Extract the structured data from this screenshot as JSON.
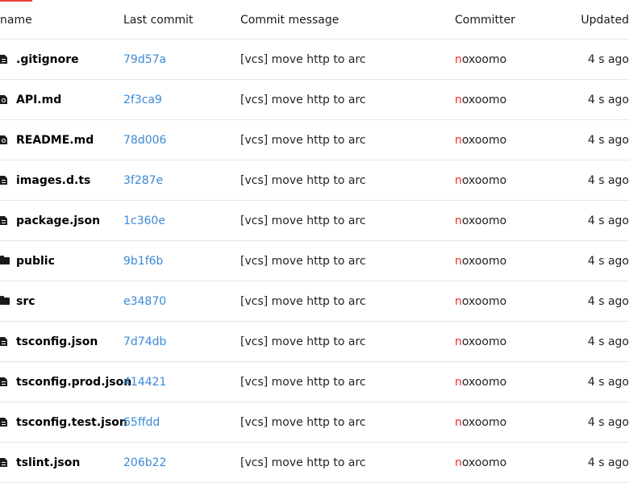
{
  "colors": {
    "accent": "#e5403a",
    "link": "#3a8ad6",
    "committer_initial": "#e5302a"
  },
  "header": {
    "name": "name",
    "last_commit": "Last commit",
    "commit_message": "Commit message",
    "committer": "Committer",
    "updated": "Updated"
  },
  "rows": [
    {
      "name": ".gitignore",
      "icon": "file-icon",
      "commit": "79d57a",
      "message": "[vcs] move http to arc",
      "committer_initial": "n",
      "committer_rest": "oxoomo",
      "updated": "4 s ago"
    },
    {
      "name": "API.md",
      "icon": "markdown-file-icon",
      "commit": "2f3ca9",
      "message": "[vcs] move http to arc",
      "committer_initial": "n",
      "committer_rest": "oxoomo",
      "updated": "4 s ago"
    },
    {
      "name": "README.md",
      "icon": "markdown-file-icon",
      "commit": "78d006",
      "message": "[vcs] move http to arc",
      "committer_initial": "n",
      "committer_rest": "oxoomo",
      "updated": "4 s ago"
    },
    {
      "name": "images.d.ts",
      "icon": "file-icon",
      "commit": "3f287e",
      "message": "[vcs] move http to arc",
      "committer_initial": "n",
      "committer_rest": "oxoomo",
      "updated": "4 s ago"
    },
    {
      "name": "package.json",
      "icon": "file-icon",
      "commit": "1c360e",
      "message": "[vcs] move http to arc",
      "committer_initial": "n",
      "committer_rest": "oxoomo",
      "updated": "4 s ago"
    },
    {
      "name": "public",
      "icon": "folder-icon",
      "commit": "9b1f6b",
      "message": "[vcs] move http to arc",
      "committer_initial": "n",
      "committer_rest": "oxoomo",
      "updated": "4 s ago"
    },
    {
      "name": "src",
      "icon": "folder-icon",
      "commit": "e34870",
      "message": "[vcs] move http to arc",
      "committer_initial": "n",
      "committer_rest": "oxoomo",
      "updated": "4 s ago"
    },
    {
      "name": "tsconfig.json",
      "icon": "file-icon",
      "commit": "7d74db",
      "message": "[vcs] move http to arc",
      "committer_initial": "n",
      "committer_rest": "oxoomo",
      "updated": "4 s ago"
    },
    {
      "name": "tsconfig.prod.json",
      "icon": "file-icon",
      "commit": "414421",
      "message": "[vcs] move http to arc",
      "committer_initial": "n",
      "committer_rest": "oxoomo",
      "updated": "4 s ago"
    },
    {
      "name": "tsconfig.test.json",
      "icon": "file-icon",
      "commit": "65ffdd",
      "message": "[vcs] move http to arc",
      "committer_initial": "n",
      "committer_rest": "oxoomo",
      "updated": "4 s ago"
    },
    {
      "name": "tslint.json",
      "icon": "file-icon",
      "commit": "206b22",
      "message": "[vcs] move http to arc",
      "committer_initial": "n",
      "committer_rest": "oxoomo",
      "updated": "4 s ago"
    }
  ]
}
